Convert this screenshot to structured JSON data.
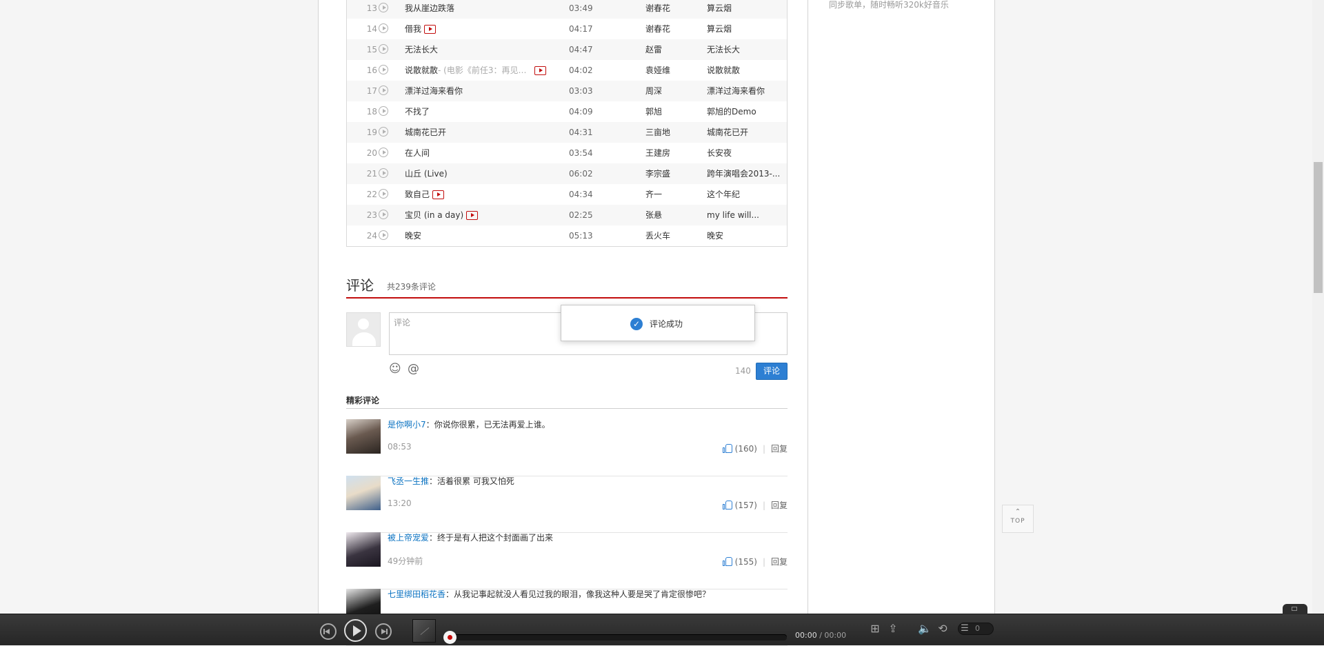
{
  "sidebar": {
    "promo_text": "同步歌单，随时畅听320k好音乐"
  },
  "tracks": [
    {
      "num": "13",
      "title": "我从崖边跌落",
      "sub": "",
      "mv": false,
      "duration": "03:49",
      "artist": "谢春花",
      "album": "算云烟"
    },
    {
      "num": "14",
      "title": "借我",
      "sub": "",
      "mv": true,
      "duration": "04:17",
      "artist": "谢春花",
      "album": "算云烟"
    },
    {
      "num": "15",
      "title": "无法长大",
      "sub": "",
      "mv": false,
      "duration": "04:47",
      "artist": "赵雷",
      "album": "无法长大"
    },
    {
      "num": "16",
      "title": "说散就散",
      "sub": " - (电影《前任3：再见前...",
      "mv": true,
      "duration": "04:02",
      "artist": "袁娅维",
      "album": "说散就散"
    },
    {
      "num": "17",
      "title": "漂洋过海来看你",
      "sub": "",
      "mv": false,
      "duration": "03:03",
      "artist": "周深",
      "album": "漂洋过海来看你"
    },
    {
      "num": "18",
      "title": "不找了",
      "sub": "",
      "mv": false,
      "duration": "04:09",
      "artist": "郭旭",
      "album": "郭旭的Demo"
    },
    {
      "num": "19",
      "title": "城南花已开",
      "sub": "",
      "mv": false,
      "duration": "04:31",
      "artist": "三亩地",
      "album": "城南花已开"
    },
    {
      "num": "20",
      "title": "在人间",
      "sub": "",
      "mv": false,
      "duration": "03:54",
      "artist": "王建房",
      "album": "长安夜"
    },
    {
      "num": "21",
      "title": "山丘 (Live)",
      "sub": "",
      "mv": false,
      "duration": "06:02",
      "artist": "李宗盛",
      "album": "跨年演唱会2013-..."
    },
    {
      "num": "22",
      "title": "致自己",
      "sub": "",
      "mv": true,
      "duration": "04:34",
      "artist": "齐一",
      "album": "这个年纪"
    },
    {
      "num": "23",
      "title": "宝贝 (in a day)",
      "sub": "",
      "mv": true,
      "duration": "02:25",
      "artist": "张悬",
      "album": "my life will..."
    },
    {
      "num": "24",
      "title": "晚安",
      "sub": "",
      "mv": false,
      "duration": "05:13",
      "artist": "丢火车",
      "album": "晚安"
    }
  ],
  "comments": {
    "heading": "评论",
    "count_text": "共239条评论",
    "placeholder": "评论",
    "emoji_icon": "☺",
    "at_icon": "@",
    "char_count": "140",
    "submit_label": "评论",
    "toast_check": "✓",
    "toast_text": "评论成功",
    "hot_heading": "精彩评论",
    "list": [
      {
        "user": "是你啊小7",
        "text": "：你说你很累，已无法再爱上谁。",
        "time": "08:53",
        "likes": "(160)",
        "reply": "回复"
      },
      {
        "user": "飞丞一生推",
        "text": "：活着很累 可我又怕死",
        "time": "13:20",
        "likes": "(157)",
        "reply": "回复"
      },
      {
        "user": "被上帝宠爱",
        "text": "：终于是有人把这个封面画了出来",
        "time": "49分钟前",
        "likes": "(155)",
        "reply": "回复"
      },
      {
        "user": "七里绑田稻花香",
        "text": "：从我记事起就没人看见过我的眼泪，像我这种人要是哭了肯定很惨吧？",
        "time": "",
        "likes": "",
        "reply": ""
      }
    ]
  },
  "back_to_top": {
    "arrow": "⌃",
    "label": "TOP"
  },
  "player": {
    "current_time": "00:00",
    "separator": " / ",
    "total_time": "00:00",
    "progress": 0,
    "playlist_count": "0",
    "icons": {
      "add": "⊞",
      "share": "⇪",
      "volume": "🔈",
      "loop": "⟲",
      "list": "☰"
    }
  },
  "colors": {
    "accent": "#c20c0c",
    "link": "#0c73c2",
    "button": "#2d7fd3"
  }
}
